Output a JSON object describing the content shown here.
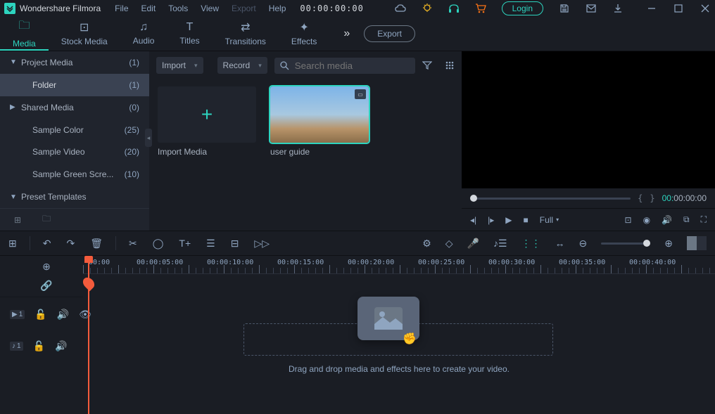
{
  "app": {
    "title": "Wondershare Filmora",
    "timecode": "00:00:00:00",
    "login": "Login"
  },
  "menu": {
    "file": "File",
    "edit": "Edit",
    "tools": "Tools",
    "view": "View",
    "export": "Export",
    "help": "Help"
  },
  "tabs": {
    "media": "Media",
    "stock": "Stock Media",
    "audio": "Audio",
    "titles": "Titles",
    "transitions": "Transitions",
    "effects": "Effects",
    "export_btn": "Export"
  },
  "sidebar": {
    "items": [
      {
        "label": "Project Media",
        "count": "(1)",
        "arrow": "▼"
      },
      {
        "label": "Folder",
        "count": "(1)"
      },
      {
        "label": "Shared Media",
        "count": "(0)",
        "arrow": "▶"
      },
      {
        "label": "Sample Color",
        "count": "(25)"
      },
      {
        "label": "Sample Video",
        "count": "(20)"
      },
      {
        "label": "Sample Green Scre...",
        "count": "(10)"
      },
      {
        "label": "Preset Templates",
        "arrow": "▼"
      }
    ]
  },
  "media_toolbar": {
    "import": "Import",
    "record": "Record",
    "search_ph": "Search media"
  },
  "media_tiles": {
    "import": "Import Media",
    "clip1": "user guide"
  },
  "preview": {
    "quality": "Full",
    "timecode_pre": "00:",
    "timecode_main": "00:00:00"
  },
  "timeline": {
    "ruler": [
      "00:00",
      "00:00:05:00",
      "00:00:10:00",
      "00:00:15:00",
      "00:00:20:00",
      "00:00:25:00",
      "00:00:30:00",
      "00:00:35:00",
      "00:00:40:00"
    ],
    "drop_text": "Drag and drop media and effects here to create your video.",
    "track_v": "1",
    "track_a": "1"
  }
}
